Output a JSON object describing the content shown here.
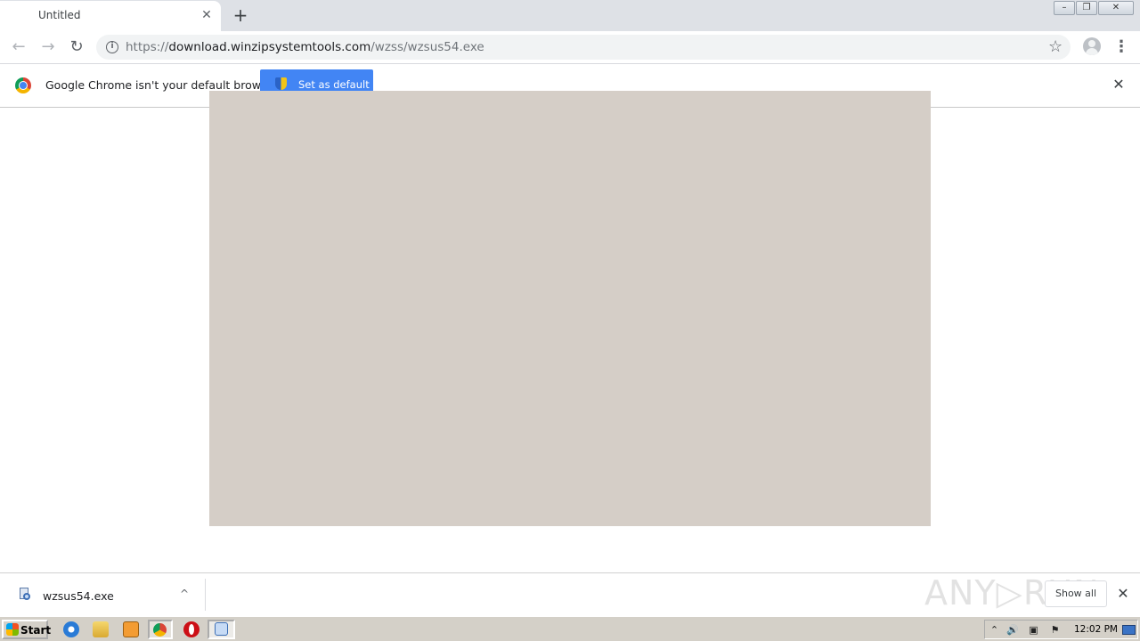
{
  "browser": {
    "tab": {
      "title": "Untitled",
      "close_glyph": "✕"
    },
    "new_tab_glyph": "+",
    "window_controls": {
      "minimize": "–",
      "restore": "❐",
      "close": "✕"
    },
    "nav": {
      "back": "←",
      "forward": "→",
      "reload": "↻"
    },
    "omnibox": {
      "info_glyph": "i",
      "url_scheme": "https://",
      "url_host": "download.winzipsystemtools.com",
      "url_path": "/wzss/wzsus54.exe"
    },
    "star_glyph": "☆",
    "menu_glyph": "⋮"
  },
  "infobar": {
    "message": "Google Chrome isn't your default browser",
    "button_label": "Set as default",
    "close_glyph": "✕"
  },
  "download_shelf": {
    "file_name": "wzsus54.exe",
    "chevron_glyph": "^",
    "show_all_label": "Show all",
    "close_glyph": "✕",
    "watermark": "ANY▷RUN"
  },
  "taskbar": {
    "start_label": "Start",
    "clock": "12:02 PM",
    "tray_glyphs": {
      "chevron": "⌃",
      "volume": "🔊",
      "network": "▣",
      "flag": "⚑"
    }
  },
  "colors": {
    "tabstrip_bg": "#dee1e6",
    "accent_blue": "#4285f4",
    "overlay_window": "#d5cec7",
    "taskbar_bg": "#d4d0c8"
  }
}
